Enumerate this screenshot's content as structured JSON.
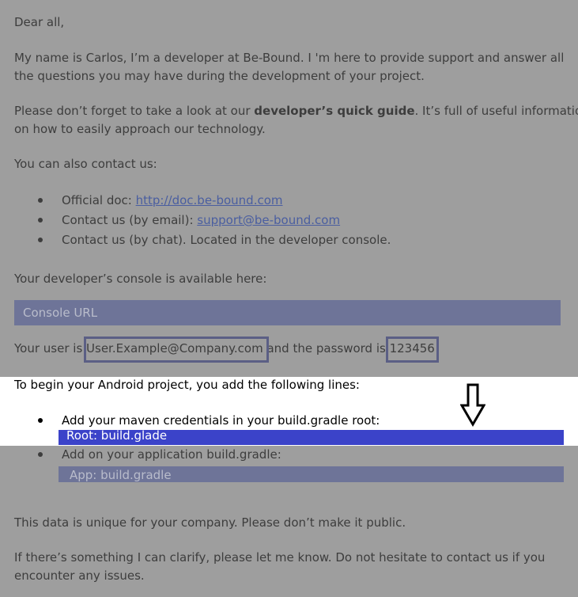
{
  "greeting": "Dear all,",
  "intro_line1": "My name is Carlos, I’m a developer at Be-Bound. I 'm here to provide support and answer all",
  "intro_line2": "the questions you may have during the development of your project.",
  "guide_line1_pre": "Please don’t forget to take a look at our ",
  "guide_bold": "developer’s quick guide",
  "guide_line1_post": ". It’s full of useful information",
  "guide_line2": "on how to easily approach our technology.",
  "contact_intro": "You can also contact us:",
  "contacts": [
    {
      "label": "Official doc: ",
      "link": "http://doc.be-bound.com"
    },
    {
      "label": "Contact us (by email):  ",
      "link": "support@be-bound.com"
    },
    {
      "label": "Contact us (by chat). Located in the developer console.",
      "link": ""
    }
  ],
  "console_intro": "Your developer’s console is available here:",
  "console_url_label": "Console URL",
  "user_pre": "Your user is ",
  "user_value": "User.Example@Company.com",
  "user_mid": " and the password is ",
  "password_value": "123456",
  "android_intro": "To begin your Android project, you add the following lines:",
  "steps": [
    {
      "label": "Add your maven credentials in your build.gradle root:",
      "code": "Root: build.glade"
    },
    {
      "label": "Add on your application build.gradle:",
      "code": "App: build.gradle"
    }
  ],
  "unique_note": "This data is unique for your company. Please don’t make it public.",
  "closing_line1": "If there’s something I can clarify, please let me know. Do not hesitate to contact us if you",
  "closing_line2": "encounter any issues.",
  "colors": {
    "dim_overlay": "#9e9e9e",
    "highlight_bar": "#3b43c9",
    "bar": "#6e7498"
  }
}
